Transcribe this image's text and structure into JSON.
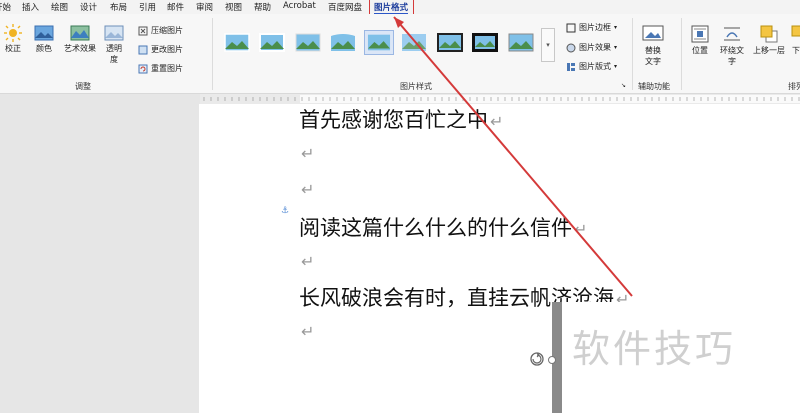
{
  "menubar": {
    "tabs": [
      "开始",
      "插入",
      "绘图",
      "设计",
      "布局",
      "引用",
      "邮件",
      "审阅",
      "视图",
      "帮助",
      "Acrobat",
      "百度网盘",
      "图片格式"
    ],
    "active_tab": "图片格式"
  },
  "ribbon": {
    "adjust": {
      "correct": "校正",
      "color": "颜色",
      "artistic": "艺术效果",
      "transparency_1": "透明",
      "transparency_2": "度",
      "compress": "压缩图片",
      "change": "更改图片",
      "reset": "重置图片",
      "group_label": "调整"
    },
    "styles": {
      "group_label": "图片样式",
      "border": "图片边框",
      "effects": "图片效果",
      "layout": "图片版式"
    },
    "accessibility": {
      "alt_text_1": "替换",
      "alt_text_2": "文字",
      "group_label": "辅助功能"
    },
    "arrange": {
      "position": "位置",
      "wrap_1": "环绕文",
      "wrap_2": "字",
      "bring_forward": "上移一层",
      "send_backward_partial": "下",
      "group_label_partial": "排列"
    }
  },
  "document": {
    "lines": [
      "首先感谢您百忙之中",
      "",
      "",
      "阅读这篇什么什么的什么信件",
      "",
      "长风破浪会有时，直挂云帆济沧海",
      ""
    ],
    "paragraph_mark": "↵",
    "anchor_mark": "⚓"
  },
  "image": {
    "watermark_text": "软件技巧"
  },
  "colors": {
    "annotation": "#d43a3a",
    "active_tab": "#1f3f9e"
  }
}
